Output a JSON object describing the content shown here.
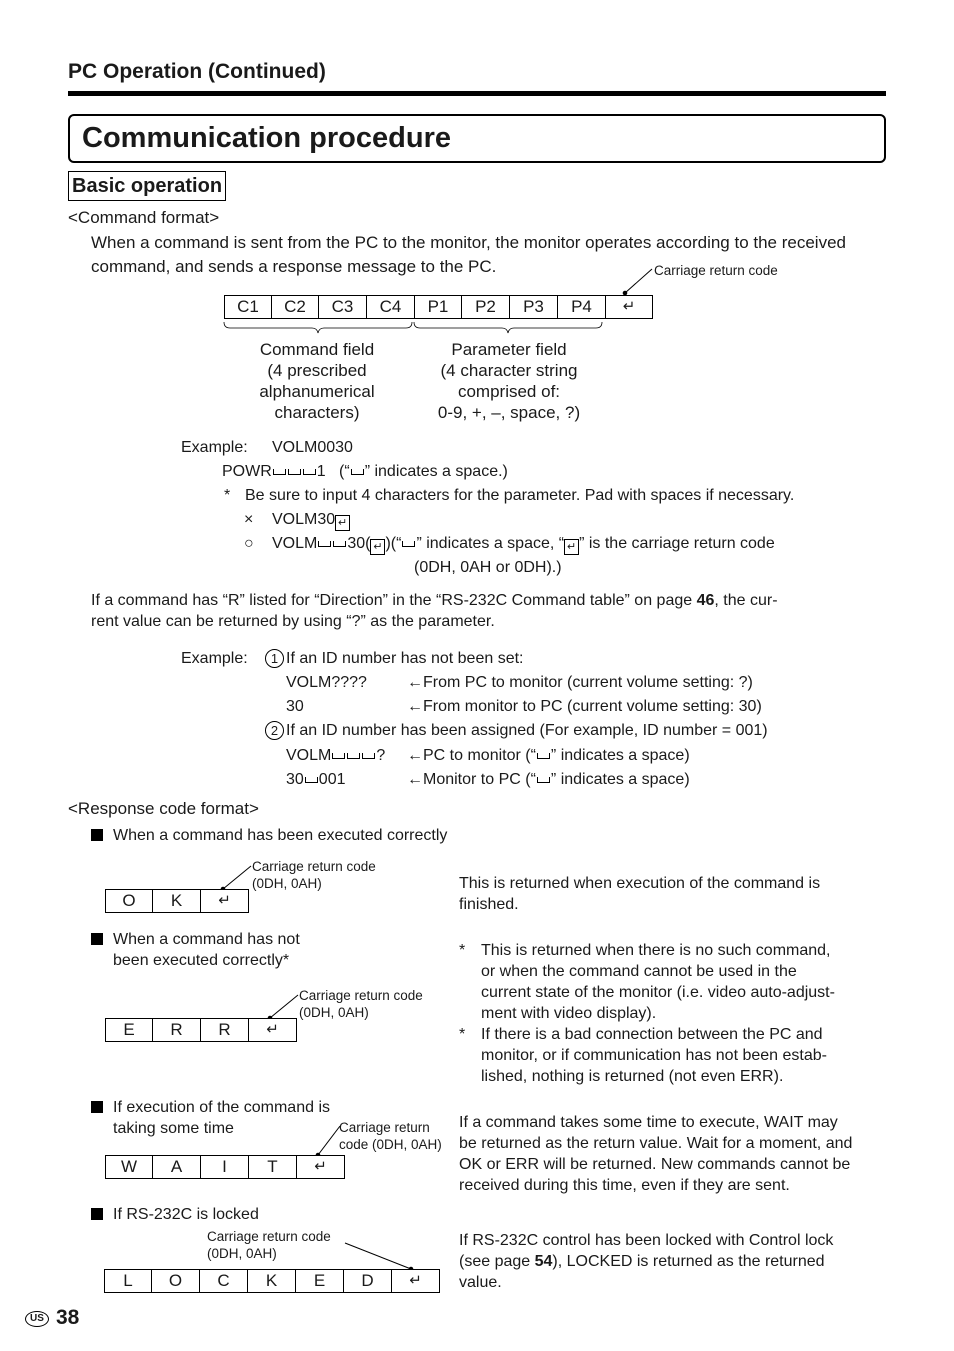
{
  "header": {
    "section": "PC Operation (Continued)",
    "title": "Communication procedure",
    "subsection": "Basic operation"
  },
  "command_format": {
    "heading": "<Command format>",
    "intro_line1": "When a command is sent from the PC to the monitor, the monitor operates according to the received",
    "intro_line2": "command, and sends a response message to the PC.",
    "cr_label": "Carriage return code",
    "cells": [
      "C1",
      "C2",
      "C3",
      "C4",
      "P1",
      "P2",
      "P3",
      "P4",
      "↵"
    ],
    "command_field": {
      "title": "Command field",
      "lines": [
        "(4 prescribed",
        "alphanumerical",
        "characters)"
      ]
    },
    "parameter_field": {
      "title": "Parameter field",
      "lines": [
        "(4 character string",
        "comprised of:",
        "0-9, +, –, space, ?)"
      ]
    },
    "example_label": "Example:",
    "example1": "VOLM0030",
    "example2_prefix": "POWR",
    "example2_suffix": "1",
    "example2_note_pre": "(“",
    "example2_note_post": "” indicates a space.)",
    "asterisk": "*",
    "note_pad": "Be sure to input 4 characters for the parameter. Pad with spaces if necessary.",
    "wrong_mark": "×",
    "wrong_example": "VOLM30",
    "right_mark": "○",
    "right_prefix": "VOLM",
    "right_mid": "30(",
    "right_close": ")",
    "right_note_a": "(“",
    "right_note_b": "” indicates a space, “",
    "right_note_c": "”  is the carriage return code",
    "right_note_line2": "(0DH, 0AH or 0DH).)",
    "cr_glyph": "↵"
  },
  "query": {
    "para_a": "If a command has “R” listed for “Direction” in the “RS-232C Command table” on page ",
    "para_page": "46",
    "para_b": ", the cur-",
    "para_line2": "rent value can be returned by using “?” as the parameter.",
    "example_label": "Example:",
    "case1_num": "1",
    "case1_title": "If an ID number has not been set:",
    "case1_rows": [
      {
        "code": "VOLM????",
        "desc": "←From PC to monitor (current volume setting: ?)"
      },
      {
        "code": "30",
        "desc": "←From monitor to PC (current volume setting: 30)"
      }
    ],
    "case2_num": "2",
    "case2_title": "If an ID number has been assigned (For example, ID number = 001)",
    "case2_row1_code_prefix": "VOLM",
    "case2_row1_code_suffix": "?",
    "case2_row1_desc_a": "←PC to monitor (“",
    "case2_row1_desc_b": "” indicates a space)",
    "case2_row2_code_prefix": "30",
    "case2_row2_code_suffix": "001",
    "case2_row2_desc_a": "←Monitor to PC (“",
    "case2_row2_desc_b": "” indicates a space)"
  },
  "response": {
    "heading": "<Response code format>",
    "cr_label_line1": "Carriage return code",
    "cr_label_line2": "(0DH, 0AH)",
    "cr_label_wait_line1": "Carriage return",
    "cr_label_wait_line2": "code (0DH, 0AH)",
    "ok": {
      "title": "When a command has been executed correctly",
      "cells": [
        "O",
        "K",
        "↵"
      ],
      "desc": [
        "This is returned when execution of the command is",
        "finished."
      ]
    },
    "err": {
      "title_line1": "When a command has not",
      "title_line2": "been executed correctly*",
      "cells": [
        "E",
        "R",
        "R",
        "↵"
      ],
      "notes": [
        [
          "This is returned when there is no such command,",
          "or when the command cannot be used in the",
          "current state of the monitor  (i.e. video auto-adjust-",
          "ment with video display)."
        ],
        [
          "If there is a bad connection between the PC and",
          "monitor, or if communication has not been estab-",
          "lished, nothing is returned (not even ERR)."
        ]
      ]
    },
    "wait": {
      "title_line1": "If execution of the command is",
      "title_line2": "taking some time",
      "cells": [
        "W",
        "A",
        "I",
        "T",
        "↵"
      ],
      "desc": [
        "If a command takes some time to execute, WAIT may",
        "be returned as the return value. Wait for a moment, and",
        "OK or ERR will be returned. New commands cannot be",
        "received during this time, even if they are sent."
      ]
    },
    "locked": {
      "title": "If RS-232C is locked",
      "cells": [
        "L",
        "O",
        "C",
        "K",
        "E",
        "D",
        "↵"
      ],
      "desc_line1": "If RS-232C control has been locked with Control lock",
      "desc_line2_a": "(see page ",
      "desc_line2_page": "54",
      "desc_line2_b": "), LOCKED is returned as the returned",
      "desc_line3": "value."
    }
  },
  "footer": {
    "region_badge": "US",
    "page_number": "38"
  }
}
